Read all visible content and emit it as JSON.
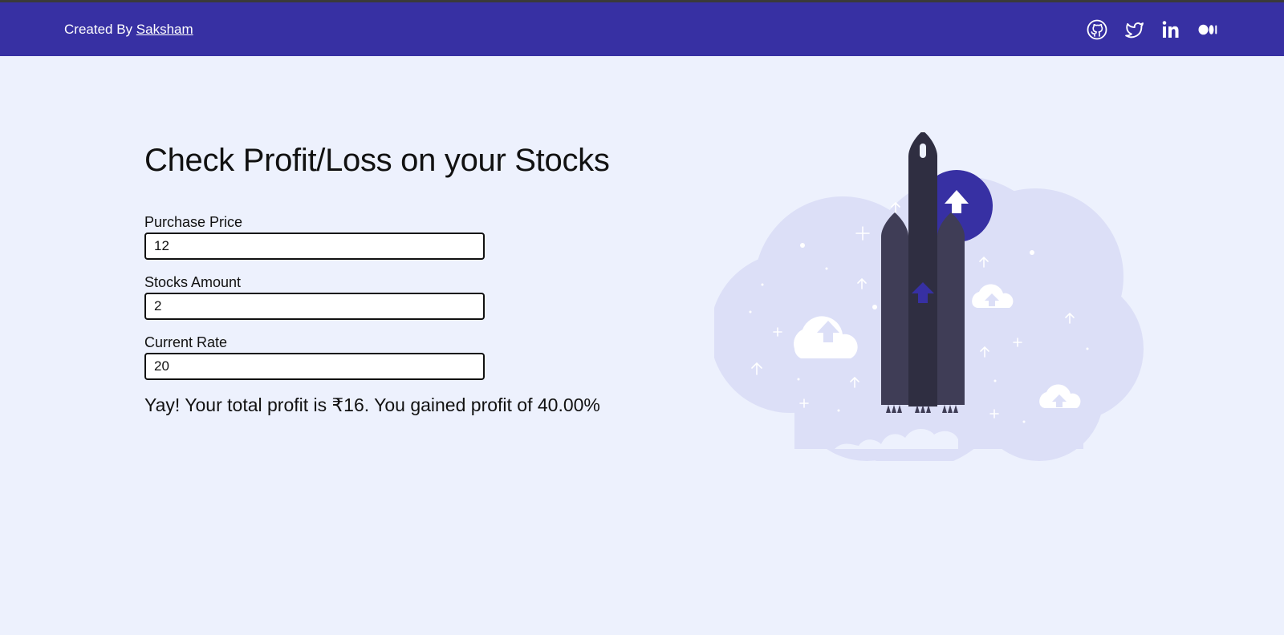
{
  "header": {
    "credit_prefix": "Created By",
    "author_name": "Saksham",
    "social_icons": [
      "github-icon",
      "twitter-icon",
      "linkedin-icon",
      "medium-icon"
    ]
  },
  "main": {
    "title": "Check Profit/Loss on your Stocks",
    "fields": [
      {
        "label": "Purchase Price",
        "value": "12"
      },
      {
        "label": "Stocks Amount",
        "value": "2"
      },
      {
        "label": "Current Rate",
        "value": "20"
      }
    ],
    "result_message": "Yay! Your total profit is ₹16. You gained profit of 40.00%"
  },
  "illustration": {
    "icon": "rocket-illustration"
  },
  "colors": {
    "header_bg": "#3730a3",
    "page_bg": "#edf1fd",
    "cloud_bg": "#dcdff7",
    "rocket_body": "#3f3d56",
    "rocket_dark": "#2f2e41",
    "accent": "#3730a3"
  }
}
